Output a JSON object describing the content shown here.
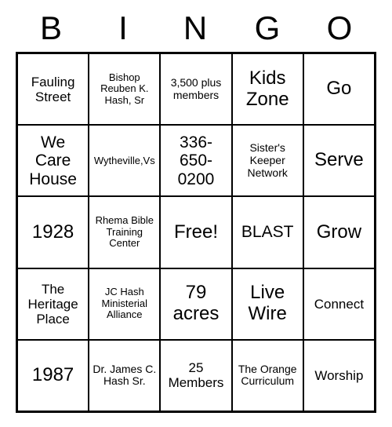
{
  "header": [
    "B",
    "I",
    "N",
    "G",
    "O"
  ],
  "grid": {
    "rows": [
      [
        {
          "text": "Fauling Street",
          "size": "med"
        },
        {
          "text": "Bishop Reuben K. Hash, Sr",
          "size": "xsmall"
        },
        {
          "text": "3,500 plus members",
          "size": "small"
        },
        {
          "text": "Kids Zone",
          "size": "lg"
        },
        {
          "text": "Go",
          "size": "lg"
        }
      ],
      [
        {
          "text": "We Care House",
          "size": ""
        },
        {
          "text": "Wytheville,Vs",
          "size": "xsmall"
        },
        {
          "text": "336-650-0200",
          "size": ""
        },
        {
          "text": "Sister's Keeper Network",
          "size": "small"
        },
        {
          "text": "Serve",
          "size": "lg"
        }
      ],
      [
        {
          "text": "1928",
          "size": "lg"
        },
        {
          "text": "Rhema Bible Training Center",
          "size": "xsmall"
        },
        {
          "text": "Free!",
          "size": "lg"
        },
        {
          "text": "BLAST",
          "size": ""
        },
        {
          "text": "Grow",
          "size": "lg"
        }
      ],
      [
        {
          "text": "The Heritage Place",
          "size": "med"
        },
        {
          "text": "JC Hash Ministerial Alliance",
          "size": "xsmall"
        },
        {
          "text": "79 acres",
          "size": "lg"
        },
        {
          "text": "Live Wire",
          "size": "lg"
        },
        {
          "text": "Connect",
          "size": "med"
        }
      ],
      [
        {
          "text": "1987",
          "size": "lg"
        },
        {
          "text": "Dr. James C. Hash Sr.",
          "size": "small"
        },
        {
          "text": "25 Members",
          "size": "med"
        },
        {
          "text": "The Orange Curriculum",
          "size": "small"
        },
        {
          "text": "Worship",
          "size": "med"
        }
      ]
    ]
  }
}
